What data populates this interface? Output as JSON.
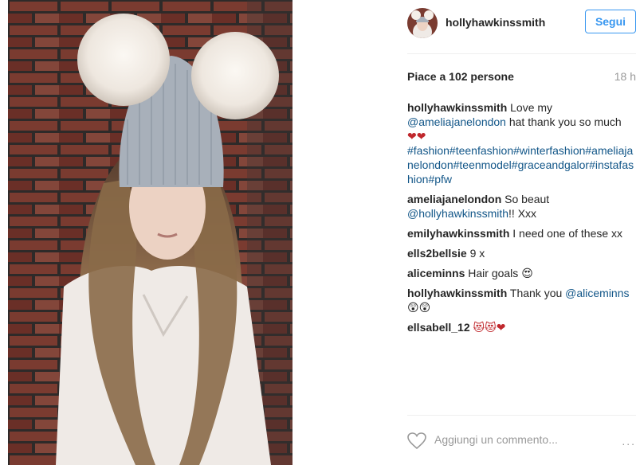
{
  "post": {
    "image": {
      "description": "photo-subject",
      "colors": {
        "brick": "#6b3a2e",
        "hat": "#a8b0ba",
        "fur": "#f4efe8",
        "hair": "#8a6a48",
        "top": "#efeae6"
      }
    },
    "header": {
      "username": "hollyhawkinssmith",
      "follow_label": "Segui",
      "follow_color": "#3897f0"
    },
    "likes": {
      "text": "Piace a 102 persone",
      "time": "18 h"
    },
    "caption": {
      "user": "hollyhawkinssmith",
      "text_before": "Love my ",
      "mention": "@ameliajanelondon",
      "text_after": " hat thank you so much ",
      "emoji": "❤❤",
      "hashtags": "#fashion#teenfashion#winterfashion#ameliajanelondon#teenmodel#graceandgalor#instafashion#pfw"
    },
    "comments": [
      {
        "user": "ameliajanelondon",
        "text_before": "So beaut ",
        "mention": "@hollyhawkinssmith",
        "text_after": "!! Xxx",
        "emoji": ""
      },
      {
        "user": "emilyhawkinssmith",
        "text_before": "I need one of these xx",
        "mention": "",
        "text_after": "",
        "emoji": ""
      },
      {
        "user": "ells2bellsie",
        "text_before": "9 x",
        "mention": "",
        "text_after": "",
        "emoji": ""
      },
      {
        "user": "aliceminns",
        "text_before": "Hair goals ",
        "mention": "",
        "text_after": "",
        "emoji": "😍"
      },
      {
        "user": "hollyhawkinssmith",
        "text_before": "Thank you ",
        "mention": "@aliceminns",
        "text_after": " ",
        "emoji": "😲😲"
      },
      {
        "user": "ellsabell_12",
        "text_before": "",
        "mention": "",
        "text_after": "",
        "emoji": "😻😻❤"
      }
    ],
    "footer": {
      "comment_placeholder": "Aggiungi un commento...",
      "like_icon": "heart-outline-icon",
      "more_label": "..."
    },
    "colors": {
      "link": "#125688",
      "muted": "#999999",
      "divider": "#efefef"
    }
  }
}
